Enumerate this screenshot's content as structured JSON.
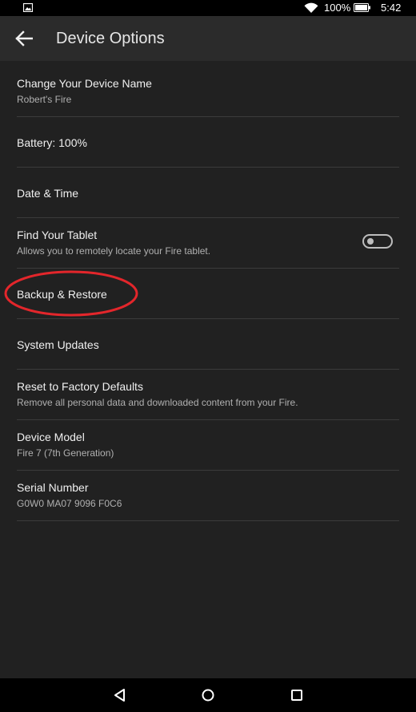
{
  "status_bar": {
    "battery_percent": "100%",
    "time": "5:42"
  },
  "app_bar": {
    "title": "Device Options"
  },
  "rows": [
    {
      "title": "Change Your Device Name",
      "subtitle": "Robert's Fire"
    },
    {
      "title": "Battery: 100%"
    },
    {
      "title": "Date & Time"
    },
    {
      "title": "Find Your Tablet",
      "subtitle": "Allows you to remotely locate your Fire tablet.",
      "toggle_on": false
    },
    {
      "title": "Backup & Restore"
    },
    {
      "title": "System Updates"
    },
    {
      "title": "Reset to Factory Defaults",
      "subtitle": "Remove all personal data and downloaded content from your Fire."
    },
    {
      "title": "Device Model",
      "subtitle": "Fire 7 (7th Generation)"
    },
    {
      "title": "Serial Number",
      "subtitle": "G0W0 MA07 9096 F0C6"
    }
  ],
  "colors": {
    "background": "#212121",
    "app_bar": "#2b2b2b",
    "annotation": "#e3262b"
  },
  "icons": {
    "status": [
      "image-icon",
      "wifi-icon",
      "battery-icon"
    ],
    "navigation": [
      "back-triangle-icon",
      "home-circle-icon",
      "recents-square-icon"
    ]
  }
}
